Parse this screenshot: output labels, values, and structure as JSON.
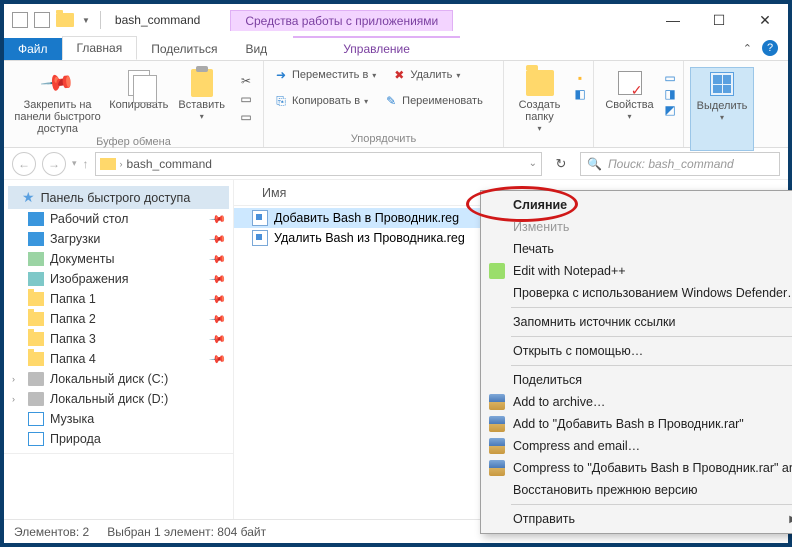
{
  "title": "bash_command",
  "contextual_tab_group": "Средства работы с приложениями",
  "tabs": {
    "file": "Файл",
    "home": "Главная",
    "share": "Поделиться",
    "view": "Вид",
    "manage": "Управление"
  },
  "ribbon": {
    "clipboard": {
      "pin": "Закрепить на панели быстрого доступа",
      "copy": "Копировать",
      "paste": "Вставить",
      "group": "Буфер обмена"
    },
    "organize": {
      "move": "Переместить в",
      "copyto": "Копировать в",
      "delete": "Удалить",
      "rename": "Переименовать",
      "group": "Упорядочить"
    },
    "newgrp": {
      "newfolder": "Создать папку"
    },
    "open": {
      "properties": "Свойства"
    },
    "select": {
      "select": "Выделить"
    }
  },
  "addr": {
    "path": "bash_command",
    "refresh": "↻",
    "search_placeholder": "Поиск: bash_command"
  },
  "sidebar": {
    "quick": "Панель быстрого доступа",
    "items": [
      "Рабочий стол",
      "Загрузки",
      "Документы",
      "Изображения",
      "Папка 1",
      "Папка 2",
      "Папка 3",
      "Папка 4",
      "Локальный диск (C:)",
      "Локальный диск (D:)",
      "Музыка",
      "Природа"
    ]
  },
  "list": {
    "col_name": "Имя",
    "files": [
      "Добавить Bash в Проводник.reg",
      "Удалить Bash из Проводника.reg"
    ]
  },
  "ctx": {
    "merge": "Слияние",
    "edit": "Изменить",
    "print": "Печать",
    "npp": "Edit with Notepad++",
    "defender": "Проверка с использованием Windows Defender…",
    "remember": "Запомнить источник ссылки",
    "openwith": "Открыть с помощью…",
    "share": "Поделиться",
    "addarch": "Add to archive…",
    "addrar": "Add to \"Добавить Bash в Проводник.rar\"",
    "compemail": "Compress and email…",
    "comprar": "Compress to \"Добавить Bash в Проводник.rar\" and ema",
    "restore": "Восстановить прежнюю версию",
    "send": "Отправить"
  },
  "status": {
    "count": "Элементов: 2",
    "sel": "Выбран 1 элемент: 804 байт"
  }
}
